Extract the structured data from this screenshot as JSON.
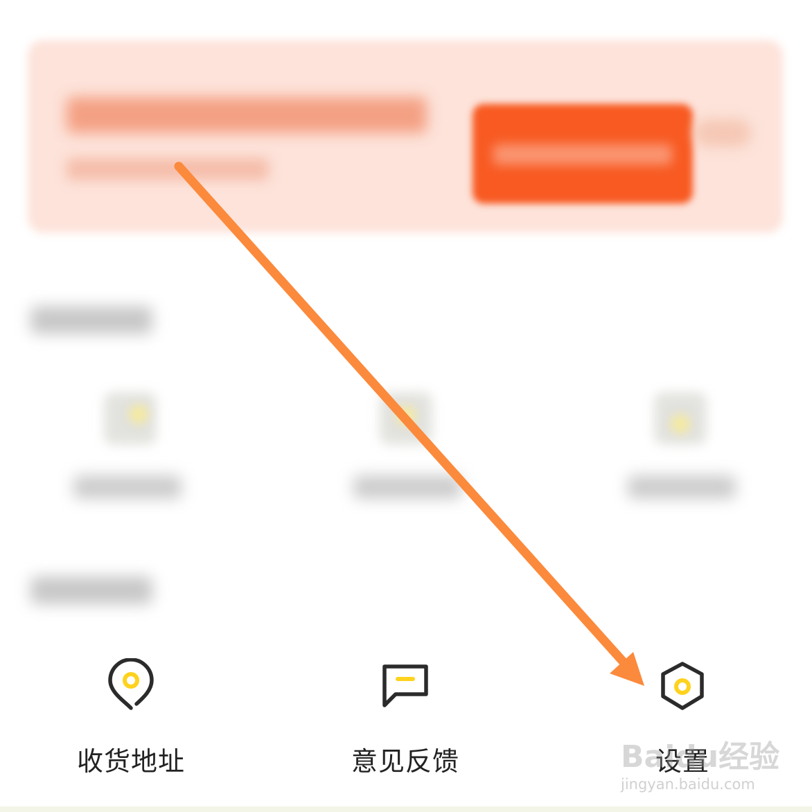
{
  "banner": {
    "title": "",
    "subtitle": "",
    "button_label": ""
  },
  "sections": [
    {
      "title": ""
    },
    {
      "title": ""
    }
  ],
  "tools": [
    {
      "label": ""
    },
    {
      "label": ""
    },
    {
      "label": ""
    }
  ],
  "services": [
    {
      "label": "收货地址",
      "icon": "location-pin-icon"
    },
    {
      "label": "意见反馈",
      "icon": "feedback-chat-icon"
    },
    {
      "label": "设置",
      "icon": "settings-hexagon-icon"
    }
  ],
  "annotation": {
    "arrow_color": "#fb8a3c"
  },
  "colors": {
    "accent_yellow": "#ffd21e",
    "icon_stroke": "#2b2b2b",
    "banner_bg": "#fde3da",
    "banner_button": "#f85a22"
  },
  "watermark": {
    "main": "Baidu经验",
    "url": "jingyan.baidu.com"
  }
}
